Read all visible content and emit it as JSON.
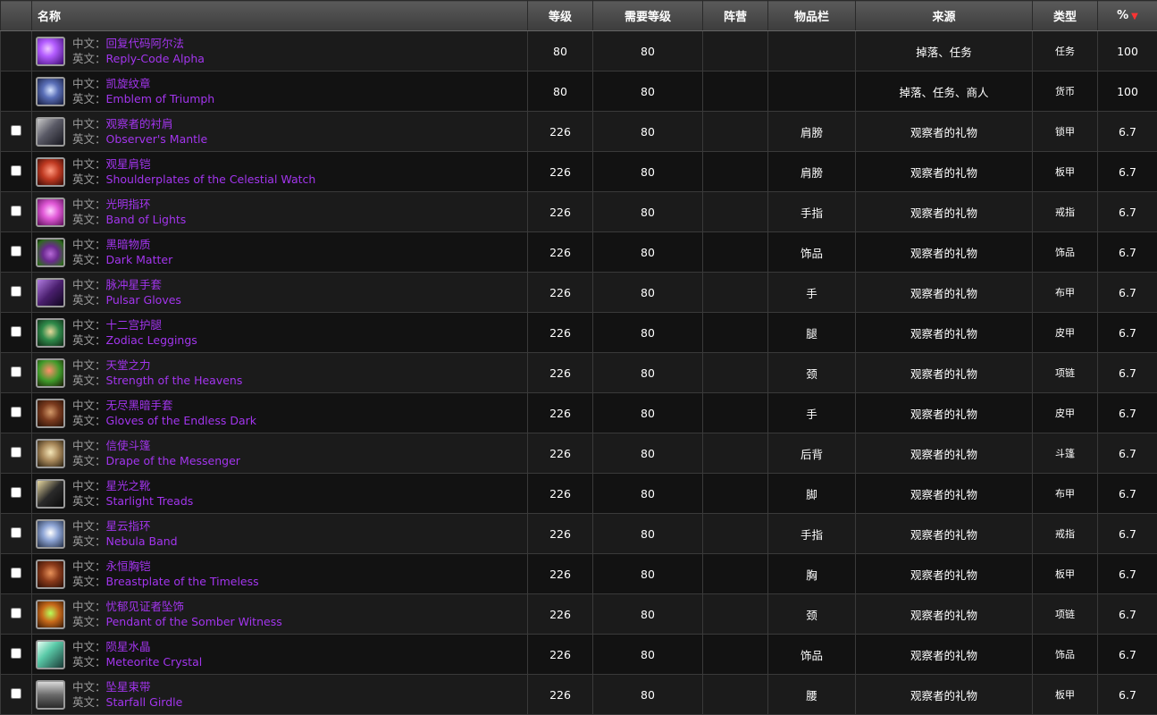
{
  "header": {
    "name": "名称",
    "level": "等级",
    "req_level": "需要等级",
    "faction": "阵营",
    "slot": "物品栏",
    "source": "来源",
    "type": "类型",
    "percent": "%"
  },
  "labels": {
    "cn": "中文：",
    "en": "英文："
  },
  "items": [
    {
      "cn": "回复代码阿尔法",
      "en": "Reply-Code Alpha",
      "level": "80",
      "req": "80",
      "faction": "",
      "slot": "",
      "source": "掉落、任务",
      "type": "任务",
      "pct": "100",
      "checkbox": false,
      "icon": "purple-code-icon"
    },
    {
      "cn": "凯旋纹章",
      "en": "Emblem of Triumph",
      "level": "80",
      "req": "80",
      "faction": "",
      "slot": "",
      "source": "掉落、任务、商人",
      "type": "货币",
      "pct": "100",
      "checkbox": false,
      "icon": "emblem-icon"
    },
    {
      "cn": "观察者的衬肩",
      "en": "Observer's Mantle",
      "level": "226",
      "req": "80",
      "faction": "",
      "slot": "肩膀",
      "source": "观察者的礼物",
      "type": "锁甲",
      "pct": "6.7",
      "checkbox": true,
      "icon": "mantle-icon"
    },
    {
      "cn": "观星肩铠",
      "en": "Shoulderplates of the Celestial Watch",
      "level": "226",
      "req": "80",
      "faction": "",
      "slot": "肩膀",
      "source": "观察者的礼物",
      "type": "板甲",
      "pct": "6.7",
      "checkbox": true,
      "icon": "shoulderplate-icon"
    },
    {
      "cn": "光明指环",
      "en": "Band of Lights",
      "level": "226",
      "req": "80",
      "faction": "",
      "slot": "手指",
      "source": "观察者的礼物",
      "type": "戒指",
      "pct": "6.7",
      "checkbox": true,
      "icon": "ring-icon"
    },
    {
      "cn": "黑暗物质",
      "en": "Dark Matter",
      "level": "226",
      "req": "80",
      "faction": "",
      "slot": "饰品",
      "source": "观察者的礼物",
      "type": "饰品",
      "pct": "6.7",
      "checkbox": true,
      "icon": "dark-matter-icon"
    },
    {
      "cn": "脉冲星手套",
      "en": "Pulsar Gloves",
      "level": "226",
      "req": "80",
      "faction": "",
      "slot": "手",
      "source": "观察者的礼物",
      "type": "布甲",
      "pct": "6.7",
      "checkbox": true,
      "icon": "gloves-icon"
    },
    {
      "cn": "十二宫护腿",
      "en": "Zodiac Leggings",
      "level": "226",
      "req": "80",
      "faction": "",
      "slot": "腿",
      "source": "观察者的礼物",
      "type": "皮甲",
      "pct": "6.7",
      "checkbox": true,
      "icon": "leggings-icon"
    },
    {
      "cn": "天堂之力",
      "en": "Strength of the Heavens",
      "level": "226",
      "req": "80",
      "faction": "",
      "slot": "颈",
      "source": "观察者的礼物",
      "type": "项链",
      "pct": "6.7",
      "checkbox": true,
      "icon": "necklace-icon"
    },
    {
      "cn": "无尽黑暗手套",
      "en": "Gloves of the Endless Dark",
      "level": "226",
      "req": "80",
      "faction": "",
      "slot": "手",
      "source": "观察者的礼物",
      "type": "皮甲",
      "pct": "6.7",
      "checkbox": true,
      "icon": "gloves-icon"
    },
    {
      "cn": "信使斗篷",
      "en": "Drape of the Messenger",
      "level": "226",
      "req": "80",
      "faction": "",
      "slot": "后背",
      "source": "观察者的礼物",
      "type": "斗篷",
      "pct": "6.7",
      "checkbox": true,
      "icon": "cloak-icon"
    },
    {
      "cn": "星光之靴",
      "en": "Starlight Treads",
      "level": "226",
      "req": "80",
      "faction": "",
      "slot": "脚",
      "source": "观察者的礼物",
      "type": "布甲",
      "pct": "6.7",
      "checkbox": true,
      "icon": "boots-icon"
    },
    {
      "cn": "星云指环",
      "en": "Nebula Band",
      "level": "226",
      "req": "80",
      "faction": "",
      "slot": "手指",
      "source": "观察者的礼物",
      "type": "戒指",
      "pct": "6.7",
      "checkbox": true,
      "icon": "ring-icon"
    },
    {
      "cn": "永恒胸铠",
      "en": "Breastplate of the Timeless",
      "level": "226",
      "req": "80",
      "faction": "",
      "slot": "胸",
      "source": "观察者的礼物",
      "type": "板甲",
      "pct": "6.7",
      "checkbox": true,
      "icon": "breastplate-icon"
    },
    {
      "cn": "忧郁见证者坠饰",
      "en": "Pendant of the Somber Witness",
      "level": "226",
      "req": "80",
      "faction": "",
      "slot": "颈",
      "source": "观察者的礼物",
      "type": "项链",
      "pct": "6.7",
      "checkbox": true,
      "icon": "pendant-icon"
    },
    {
      "cn": "陨星水晶",
      "en": "Meteorite Crystal",
      "level": "226",
      "req": "80",
      "faction": "",
      "slot": "饰品",
      "source": "观察者的礼物",
      "type": "饰品",
      "pct": "6.7",
      "checkbox": true,
      "icon": "crystal-icon"
    },
    {
      "cn": "坠星束带",
      "en": "Starfall Girdle",
      "level": "226",
      "req": "80",
      "faction": "",
      "slot": "腰",
      "source": "观察者的礼物",
      "type": "板甲",
      "pct": "6.7",
      "checkbox": true,
      "icon": "girdle-icon"
    }
  ]
}
